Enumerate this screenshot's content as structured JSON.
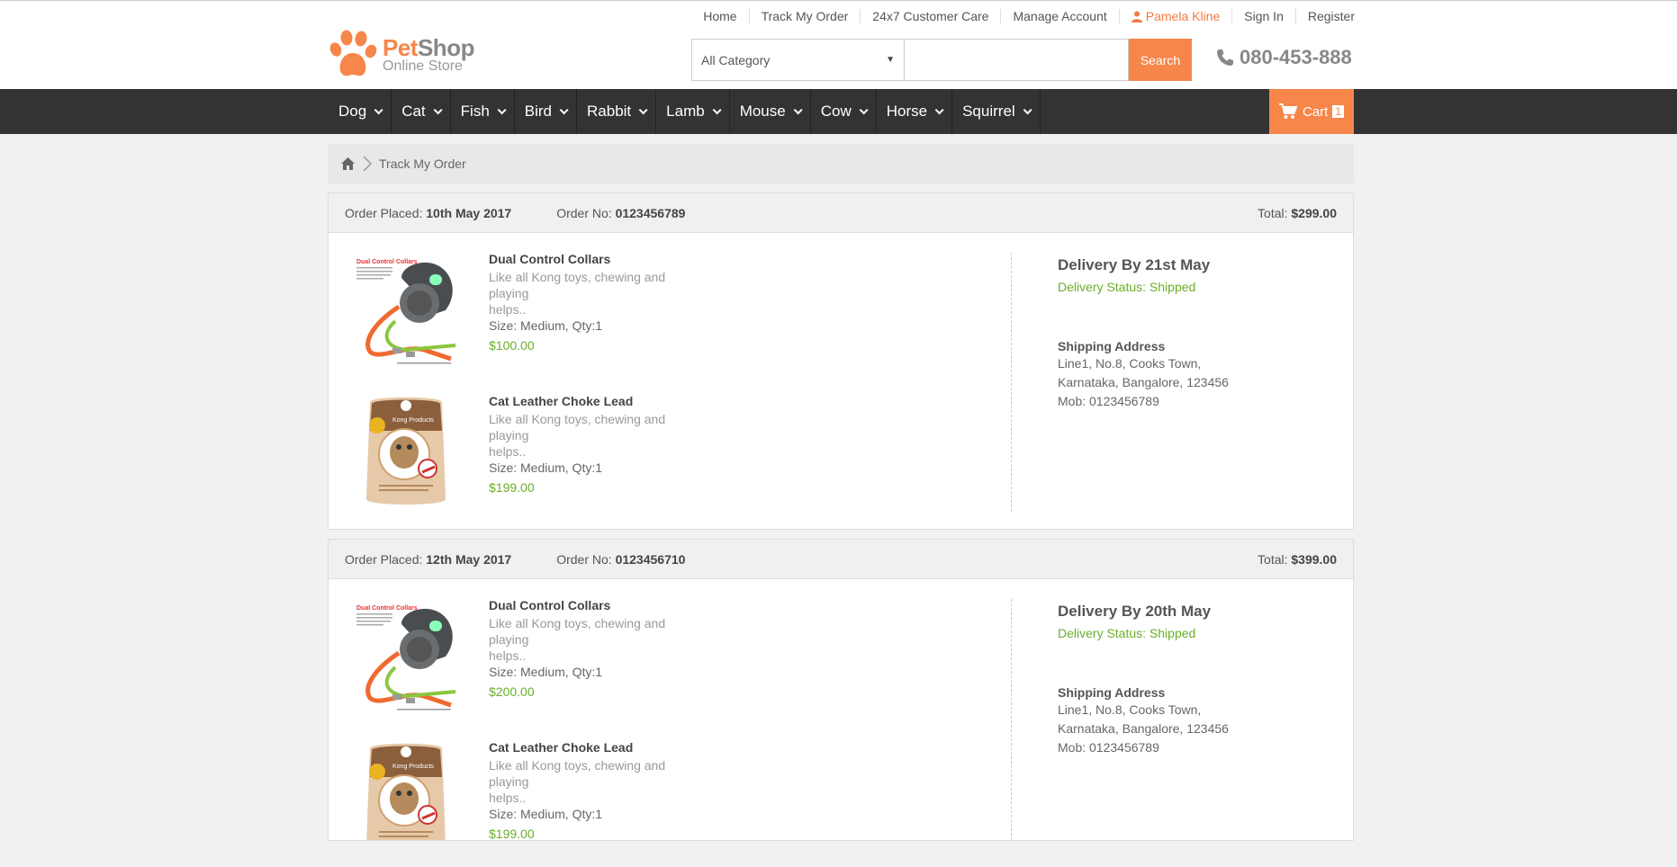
{
  "toplinks": {
    "home": "Home",
    "track": "Track My Order",
    "care": "24x7 Customer Care",
    "manage": "Manage Account",
    "user": "Pamela Kline",
    "signin": "Sign In",
    "register": "Register"
  },
  "logo": {
    "pet": "Pet",
    "shop": "Shop",
    "sub": "Online Store"
  },
  "search": {
    "category": "All Category",
    "placeholder": "",
    "button": "Search"
  },
  "phone": "080-453-888",
  "nav": [
    "Dog",
    "Cat",
    "Fish",
    "Bird",
    "Rabbit",
    "Lamb",
    "Mouse",
    "Cow",
    "Horse",
    "Squirrel"
  ],
  "cart": {
    "label": "Cart",
    "count": "1"
  },
  "breadcrumb": {
    "current": "Track My Order"
  },
  "colors": {
    "accent": "#f7864b",
    "nav_bg": "#333333",
    "green": "#6aae29"
  },
  "orders": [
    {
      "placed_label": "Order Placed:",
      "placed": "10th May 2017",
      "no_label": "Order No:",
      "no": "0123456789",
      "total_label": "Total:",
      "total": "$299.00",
      "items": [
        {
          "name": "Dual Control Collars",
          "desc1": "Like all Kong toys, chewing and playing",
          "desc2": "helps..",
          "size": "Size: Medium, Qty:1",
          "price": "$100.00",
          "image": "collar-product-image"
        },
        {
          "name": "Cat Leather Choke Lead",
          "desc1": "Like all Kong toys, chewing and playing",
          "desc2": "helps..",
          "size": "Size: Medium, Qty:1",
          "price": "$199.00",
          "image": "kong-product-image"
        }
      ],
      "delivery": "Delivery By 21st May",
      "status": "Delivery Status: Shipped",
      "ship_label": "Shipping Address",
      "addr1": "Line1, No.8, Cooks Town,",
      "addr2": "Karnataka, Bangalore, 123456",
      "mob": "Mob: 0123456789"
    },
    {
      "placed_label": "Order Placed:",
      "placed": "12th May 2017",
      "no_label": "Order No:",
      "no": "0123456710",
      "total_label": "Total:",
      "total": "$399.00",
      "items": [
        {
          "name": "Dual Control Collars",
          "desc1": "Like all Kong toys, chewing and playing",
          "desc2": "helps..",
          "size": "Size: Medium, Qty:1",
          "price": "$200.00",
          "image": "collar-product-image"
        },
        {
          "name": "Cat Leather Choke Lead",
          "desc1": "Like all Kong toys, chewing and playing",
          "desc2": "helps..",
          "size": "Size: Medium, Qty:1",
          "price": "$199.00",
          "image": "kong-product-image"
        }
      ],
      "delivery": "Delivery By 20th May",
      "status": "Delivery Status: Shipped",
      "ship_label": "Shipping Address",
      "addr1": "Line1, No.8, Cooks Town,",
      "addr2": "Karnataka, Bangalore, 123456",
      "mob": "Mob: 0123456789"
    }
  ]
}
